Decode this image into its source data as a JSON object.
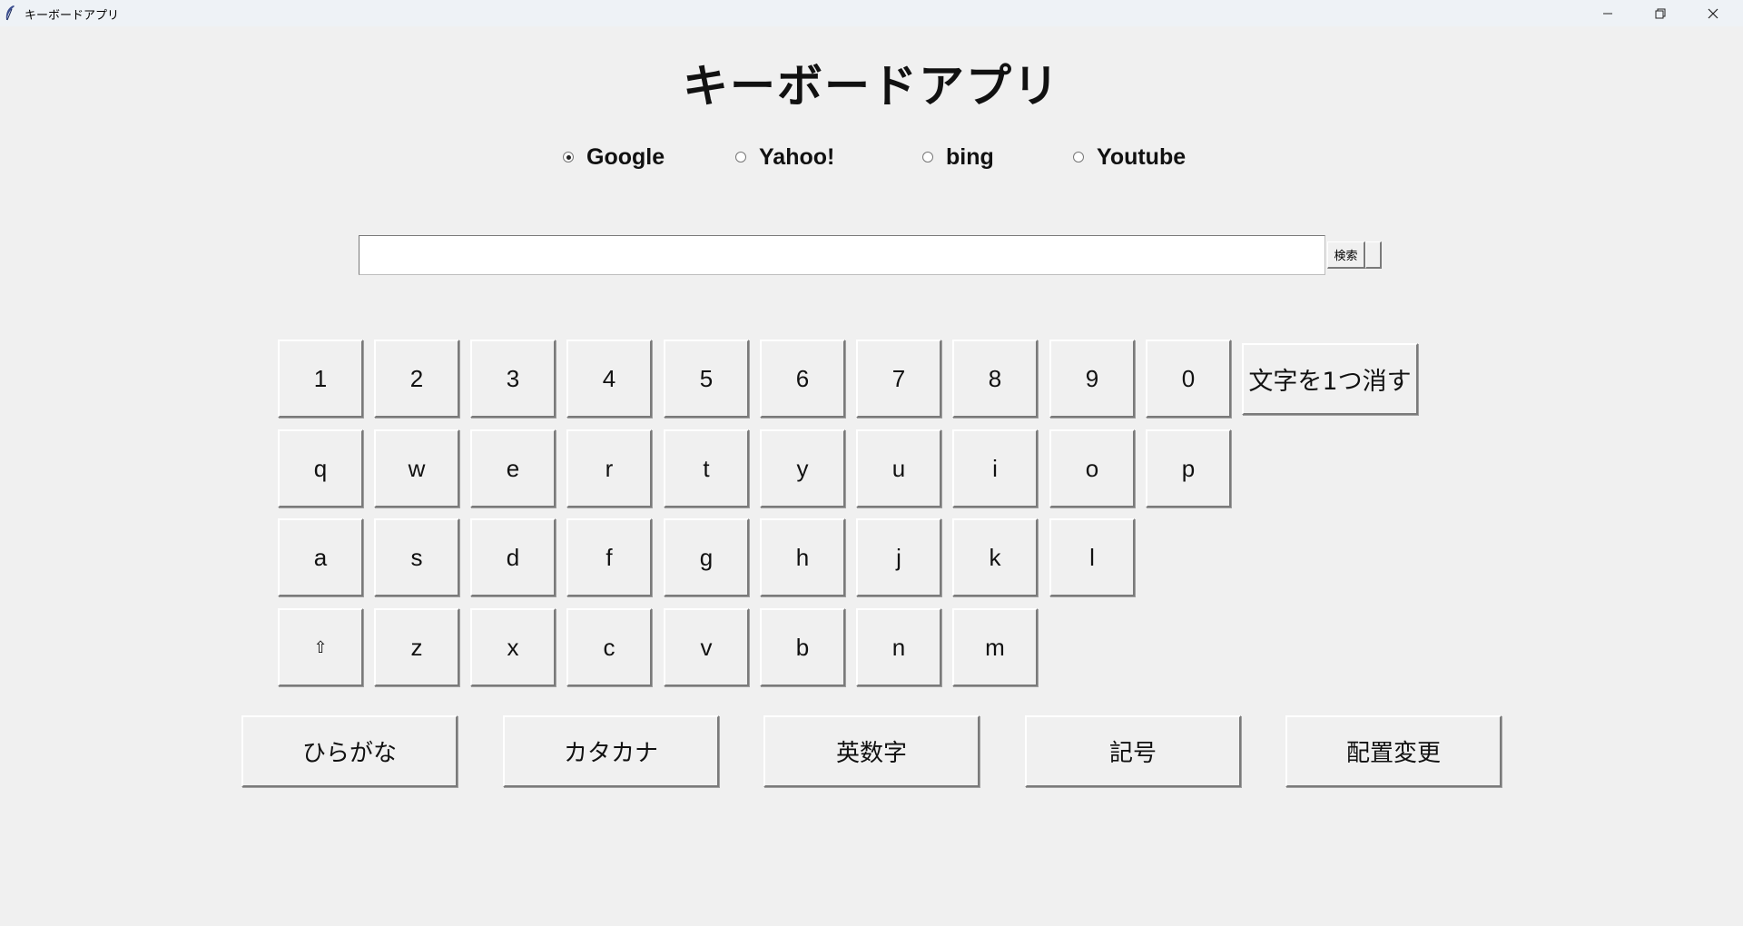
{
  "window": {
    "title": "キーボードアプリ",
    "controls": [
      "minimize-icon",
      "restore-icon",
      "close-icon"
    ]
  },
  "heading": "キーボードアプリ",
  "search_engines": {
    "options": [
      "Google",
      "Yahoo!",
      "bing",
      "Youtube"
    ],
    "selected": "Google"
  },
  "search": {
    "value": "",
    "button_label": "検索"
  },
  "keyboard": {
    "row_numbers": [
      "1",
      "2",
      "3",
      "4",
      "5",
      "6",
      "7",
      "8",
      "9",
      "0"
    ],
    "row_q": [
      "q",
      "w",
      "e",
      "r",
      "t",
      "y",
      "u",
      "i",
      "o",
      "p"
    ],
    "row_a": [
      "a",
      "s",
      "d",
      "f",
      "g",
      "h",
      "j",
      "k",
      "l"
    ],
    "row_z": [
      "⇧",
      "z",
      "x",
      "c",
      "v",
      "b",
      "n",
      "m"
    ],
    "backspace_label": "文字を1つ消す"
  },
  "mode_buttons": [
    "ひらがな",
    "カタカナ",
    "英数字",
    "記号",
    "配置変更"
  ]
}
